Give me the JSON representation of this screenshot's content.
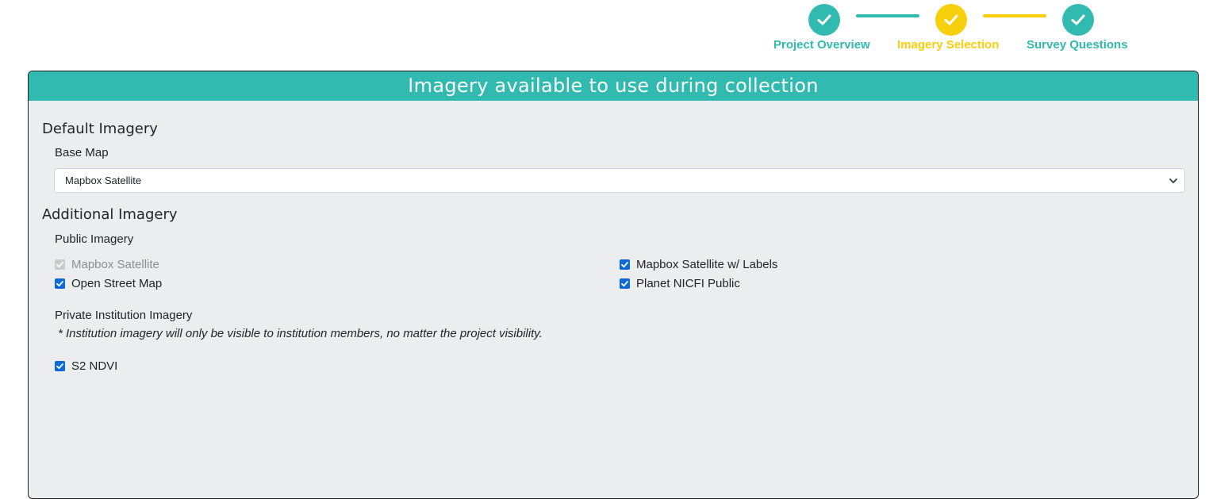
{
  "stepper": {
    "steps": [
      {
        "label": "Project Overview",
        "status": "complete",
        "color": "#31bab0"
      },
      {
        "label": "Imagery Selection",
        "status": "current",
        "color": "#f7cf0a"
      },
      {
        "label": "Survey Questions",
        "status": "complete",
        "color": "#31bab0"
      }
    ],
    "icon": "check-icon"
  },
  "panel": {
    "title": "Imagery available to use during collection",
    "header_color": "#31bab0",
    "default_imagery": {
      "heading": "Default Imagery",
      "base_map_label": "Base Map",
      "base_map_value": "Mapbox Satellite"
    },
    "additional_imagery": {
      "heading": "Additional Imagery",
      "public_label": "Public Imagery",
      "public_items": [
        {
          "label": "Mapbox Satellite",
          "checked": true,
          "disabled": true
        },
        {
          "label": "Mapbox Satellite w/ Labels",
          "checked": true,
          "disabled": false
        },
        {
          "label": "Open Street Map",
          "checked": true,
          "disabled": false
        },
        {
          "label": "Planet NICFI Public",
          "checked": true,
          "disabled": false
        }
      ],
      "private_label": "Private Institution Imagery",
      "private_note": "* Institution imagery will only be visible to institution members, no matter the project visibility.",
      "private_items": [
        {
          "label": "S2 NDVI",
          "checked": true,
          "disabled": false
        }
      ]
    }
  }
}
